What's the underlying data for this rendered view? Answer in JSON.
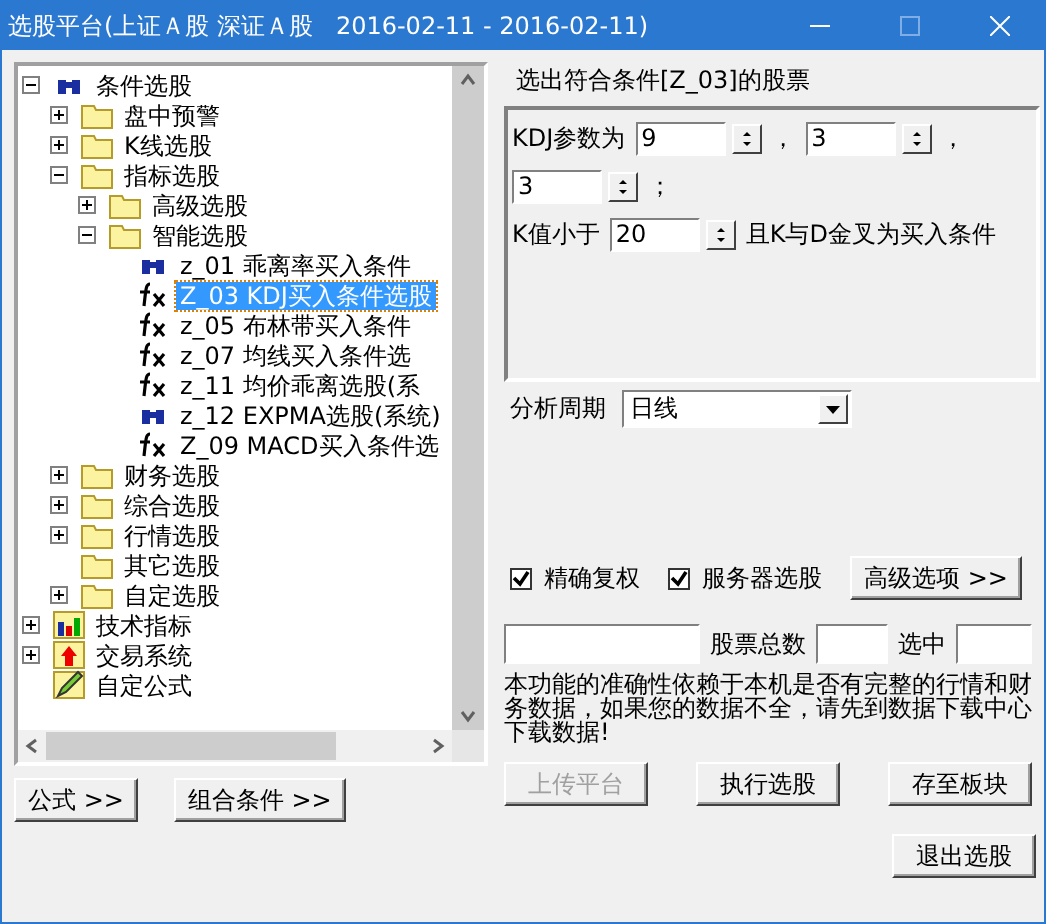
{
  "window": {
    "title": "选股平台(上证Ａ股 深证Ａ股   2016-02-11 - 2016-02-11)"
  },
  "tree": [
    {
      "label": "条件选股",
      "kind": "binoculars",
      "expanded": true,
      "children": [
        {
          "label": "盘中预警",
          "kind": "folder",
          "expanded": false
        },
        {
          "label": "K线选股",
          "kind": "folder",
          "expanded": false
        },
        {
          "label": "指标选股",
          "kind": "folder",
          "expanded": true,
          "children": [
            {
              "label": "高级选股",
              "kind": "folder",
              "expanded": false
            },
            {
              "label": "智能选股",
              "kind": "folder",
              "expanded": true,
              "children": [
                {
                  "label": "z_01 乖离率买入条件",
                  "kind": "binoculars",
                  "selected": false
                },
                {
                  "label": "Z_03 KDJ买入条件选股",
                  "kind": "formula",
                  "selected": true
                },
                {
                  "label": "z_05 布林带买入条件",
                  "kind": "formula",
                  "selected": false
                },
                {
                  "label": "z_07 均线买入条件选",
                  "kind": "formula",
                  "selected": false
                },
                {
                  "label": "z_11 均价乖离选股(系",
                  "kind": "formula",
                  "selected": false
                },
                {
                  "label": "z_12 EXPMA选股(系统)",
                  "kind": "binoculars",
                  "selected": false
                },
                {
                  "label": "Z_09 MACD买入条件选",
                  "kind": "formula",
                  "selected": false
                }
              ]
            }
          ]
        },
        {
          "label": "财务选股",
          "kind": "folder",
          "expanded": false
        },
        {
          "label": "综合选股",
          "kind": "folder",
          "expanded": false
        },
        {
          "label": "行情选股",
          "kind": "folder",
          "expanded": false
        },
        {
          "label": "其它选股",
          "kind": "folder"
        },
        {
          "label": "自定选股",
          "kind": "folder",
          "expanded": false
        }
      ]
    },
    {
      "label": "技术指标",
      "kind": "chart",
      "expanded": false
    },
    {
      "label": "交易系统",
      "kind": "arrow",
      "expanded": false
    },
    {
      "label": "自定公式",
      "kind": "pencil"
    }
  ],
  "left_buttons": [
    "公式 >>",
    "组合条件 >>"
  ],
  "condition_title": "选出符合条件[Z_03]的股票",
  "params": {
    "kdj_label": "KDJ参数为",
    "kdj_values": [
      "9",
      "3",
      "3"
    ],
    "separators": [
      "，",
      "，",
      "；"
    ],
    "k_label": "K值小于",
    "k_value": "20",
    "k_suffix": "且K与D金叉为买入条件"
  },
  "period": {
    "label": "分析周期",
    "value": "日线"
  },
  "checkboxes": [
    {
      "label": "精确复权",
      "checked": true
    },
    {
      "label": "服务器选股",
      "checked": true
    }
  ],
  "advanced_button": "高级选项 >>",
  "counts": {
    "total_label": "股票总数",
    "selected_label": "选中"
  },
  "notice": "本功能的准确性依赖于本机是否有完整的行情和财务数据，如果您的数据不全，请先到数据下载中心下载数据!",
  "buttons": [
    {
      "label": "上传平台",
      "disabled": true
    },
    {
      "label": "执行选股",
      "disabled": false
    },
    {
      "label": "存至板块",
      "disabled": false
    }
  ],
  "exit_button": "退出选股"
}
